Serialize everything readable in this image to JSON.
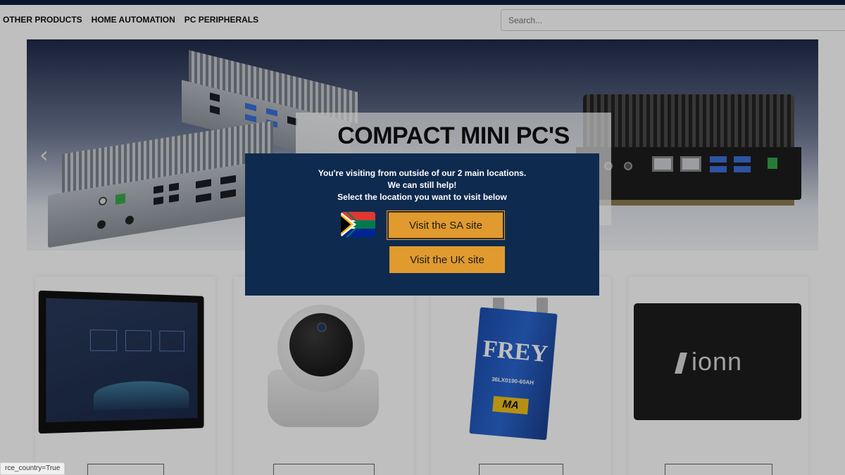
{
  "nav": {
    "items": [
      {
        "label": "OTHER PRODUCTS"
      },
      {
        "label": "HOME AUTOMATION"
      },
      {
        "label": "PC PERIPHERALS"
      }
    ],
    "search_placeholder": "Search..."
  },
  "hero": {
    "title": "COMPACT MINI PC'S",
    "prev_arrow": "‹",
    "next_arrow": "›"
  },
  "cards": {
    "battery_brand": "FREY",
    "battery_model": "36LX0190-60AH",
    "battery_badge": "MA",
    "ssd_brand": "ionn"
  },
  "modal": {
    "line1": "You're visiting from outside of our 2 main locations.",
    "line2": "We can still help!",
    "line3": "Select the location you want to visit below",
    "sa_button": "Visit the SA site",
    "uk_button": "Visit the UK site"
  },
  "status_bar": {
    "text": "rce_country=True"
  },
  "colors": {
    "topbar": "#0f1e3c",
    "modal_bg": "#0f2a4f",
    "button": "#e09a2e"
  }
}
